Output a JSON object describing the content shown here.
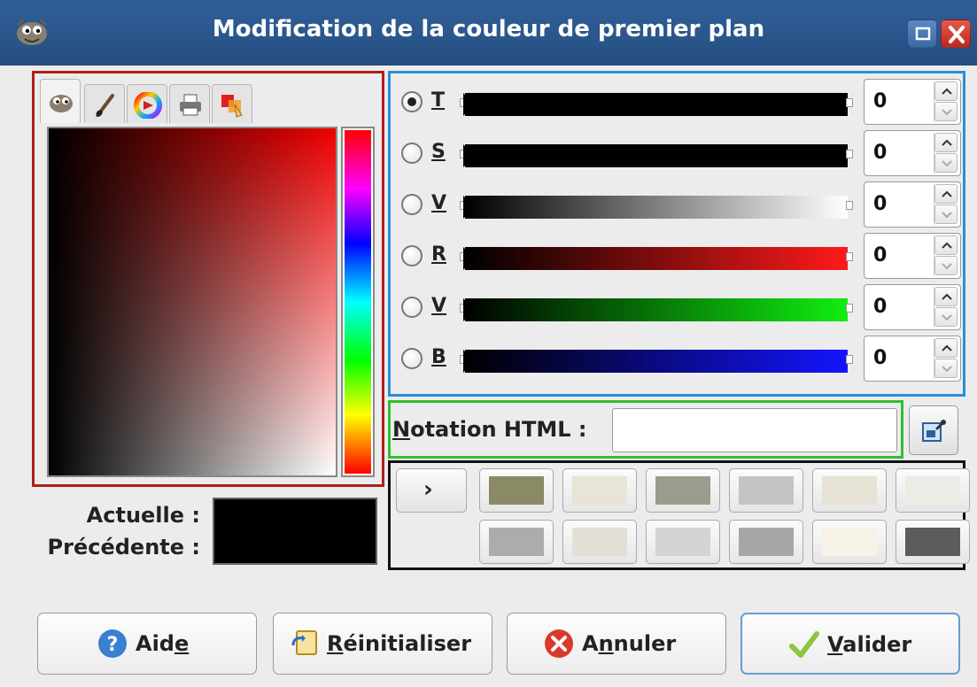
{
  "window": {
    "title": "Modification de la couleur de premier plan"
  },
  "selector_tabs": [
    {
      "icon": "gimp-icon",
      "active": true
    },
    {
      "icon": "paintbrush-icon",
      "active": false
    },
    {
      "icon": "color-wheel-icon",
      "active": false
    },
    {
      "icon": "printer-icon",
      "active": false
    },
    {
      "icon": "watercolor-icon",
      "active": false
    }
  ],
  "current_label": "Actuelle :",
  "previous_label": "Précédente :",
  "current_color": "#000000",
  "previous_color": "#000000",
  "scales": [
    {
      "letter": "T",
      "value": "0",
      "checked": true,
      "gradient": "#000000"
    },
    {
      "letter": "S",
      "value": "0",
      "checked": false,
      "gradient": "#000000"
    },
    {
      "letter": "V",
      "value": "0",
      "checked": false,
      "gradient": "linear-gradient(to right,#000,#fff)"
    },
    {
      "letter": "R",
      "value": "0",
      "checked": false,
      "gradient": "linear-gradient(to right,#000,#ff1a1a)"
    },
    {
      "letter": "V",
      "value": "0",
      "checked": false,
      "gradient": "linear-gradient(to right,#000,#10ee10)"
    },
    {
      "letter": "B",
      "value": "0",
      "checked": false,
      "gradient": "linear-gradient(to right,#000,#1414ff)"
    }
  ],
  "html_notation": {
    "label_underlined": "N",
    "label_rest": "otation HTML :",
    "value": "",
    "picker_icon": "color-picker-icon"
  },
  "history": {
    "toggle_label": "›",
    "row1": [
      "#8a8a66",
      "#e8e4d6",
      "#9a9c8c",
      "#c4c4c4",
      "#e6e2d4",
      "#ecebe6"
    ],
    "row2": [
      "#acacac",
      "#e2e0d6",
      "#d4d4d4",
      "#a6a6a4",
      "#f6f2e8",
      "#5c5c5c"
    ]
  },
  "buttons": {
    "aide": {
      "pre": "Aid",
      "ul": "e",
      "post": "",
      "icon": "help-icon"
    },
    "reinit": {
      "pre": "",
      "ul": "R",
      "post": "éinitialiser",
      "icon": "reset-icon"
    },
    "annuler": {
      "pre": "A",
      "ul": "n",
      "post": "nuler",
      "icon": "cancel-icon"
    },
    "valider": {
      "pre": "",
      "ul": "V",
      "post": "alider",
      "icon": "checkmark-icon"
    }
  }
}
